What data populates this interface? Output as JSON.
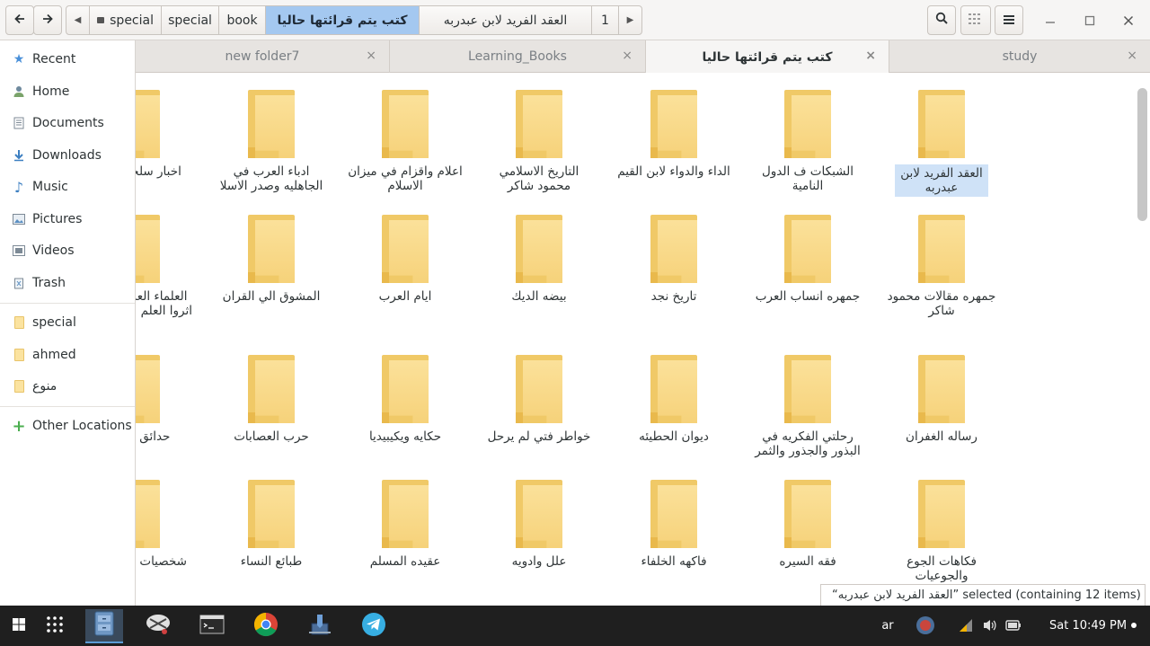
{
  "header": {
    "back_icon": "arrow-left-icon",
    "forward_icon": "arrow-right-icon",
    "path": {
      "crumbs": [
        "special",
        "special",
        "book",
        "كتب يتم قرائتها حاليا",
        "العقد الفريد لابن عبدربه",
        "1"
      ],
      "active_index": 3
    },
    "search_icon": "search-icon",
    "view_icon": "grid-view-icon",
    "menu_icon": "menu-icon"
  },
  "sidebar": {
    "items": [
      {
        "label": "Recent",
        "icon": "star-icon"
      },
      {
        "label": "Home",
        "icon": "home-icon"
      },
      {
        "label": "Documents",
        "icon": "document-icon"
      },
      {
        "label": "Downloads",
        "icon": "download-icon"
      },
      {
        "label": "Music",
        "icon": "music-icon"
      },
      {
        "label": "Pictures",
        "icon": "picture-icon"
      },
      {
        "label": "Videos",
        "icon": "video-icon"
      },
      {
        "label": "Trash",
        "icon": "trash-icon"
      }
    ],
    "bookmarks": [
      {
        "label": "special"
      },
      {
        "label": "ahmed"
      },
      {
        "label": "منوع"
      }
    ],
    "other": {
      "label": "Other Locations",
      "icon": "plus-icon"
    }
  },
  "tabs": [
    {
      "label": "new folder7"
    },
    {
      "label": "Learning_Books"
    },
    {
      "label": "كتب يتم قرائتها حاليا",
      "active": true
    },
    {
      "label": "study"
    }
  ],
  "folders": [
    "العقد الفريد لابن عبدربه",
    "الشبكات ف الدول النامية",
    "الداء والدواء لابن القيم",
    "التاريخ الاسلامي محمود شاكر",
    "اعلام واقزام في ميزان الاسلام",
    "ادباء العرب في الجاهليه وصدر الاسلا",
    "اخبار سلجوق نامه",
    "جمهره مقالات محمود شاكر",
    "جمهره انساب العرب",
    "تاريخ نجد",
    "بيضه الديك",
    "ايام العرب",
    "المشوق الي القران",
    "العلماء العزاب الذين اثروا العلم علي الزواج",
    "رساله الغفران",
    "رحلتي الفكريه في البذور والجذور والثمر",
    "ديوان الحطيئه",
    "خواطر فتي لم يرحل",
    "حكايه ويكيبيديا",
    "حرب العصابات",
    "حدائق الازاهر",
    "فكاهات الجوع والجوعيات",
    "فقه السيره",
    "فاكهه الخلفاء",
    "علل وادويه",
    "عقيده المسلم",
    "طبائع النساء",
    "شخصيات لها العجب"
  ],
  "selected_index": 0,
  "status": {
    "text": "“العقد الفريد لابن عبدربه” selected  (containing 12 items)"
  },
  "taskbar": {
    "language": "ar",
    "clock": "Sat 10:49 PM"
  }
}
